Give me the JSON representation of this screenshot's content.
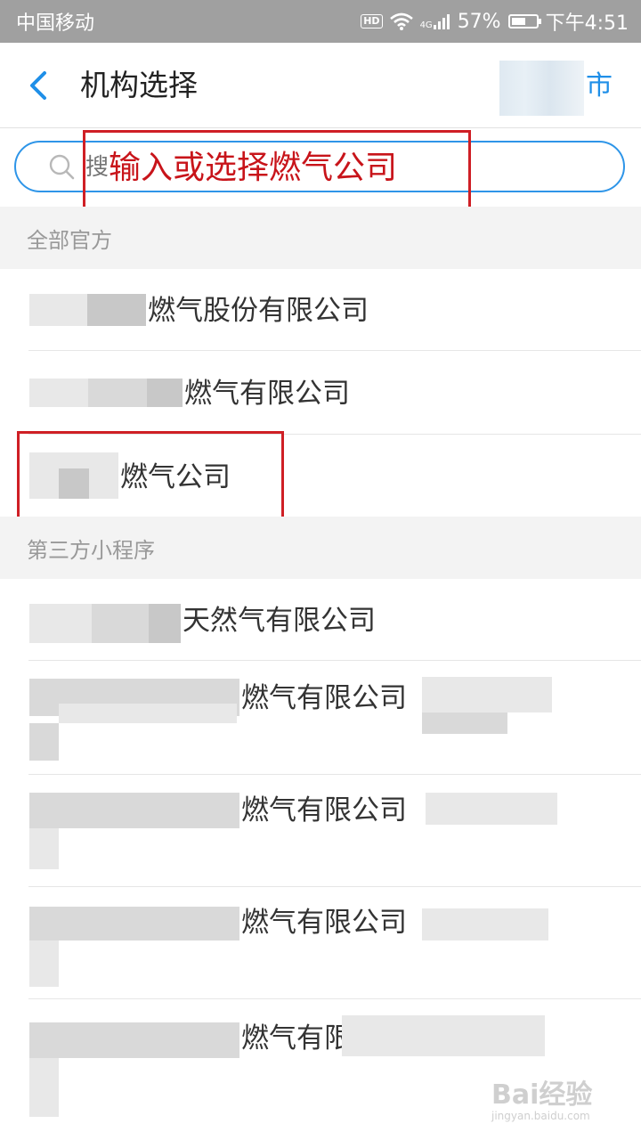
{
  "status_bar": {
    "carrier": "中国移动",
    "hd": "HD",
    "network": "4G",
    "battery": "57%",
    "battery_level": 0.57,
    "time": "下午4:51"
  },
  "header": {
    "title": "机构选择",
    "city_suffix": "市",
    "back_icon": "chevron-left-icon",
    "accent_color": "#1f8fe8"
  },
  "search": {
    "placeholder": "搜",
    "icon": "search-icon",
    "annotation": "输入或选择燃气公司",
    "annotation_color": "#c8141a"
  },
  "sections": [
    {
      "label": "全部官方",
      "items": [
        {
          "name": "燃气股份有限公司"
        },
        {
          "name": "燃气有限公司"
        },
        {
          "name": "燃气公司"
        }
      ]
    },
    {
      "label": "第三方小程序",
      "items": [
        {
          "name": "天然气有限公司"
        },
        {
          "name": "燃气有限公司"
        },
        {
          "name": "燃气有限公司"
        },
        {
          "name": "燃气有限公司"
        },
        {
          "name": "燃气有限"
        }
      ]
    }
  ],
  "watermark": {
    "brand": "Bai经验",
    "url": "jingyan.baidu.com"
  }
}
